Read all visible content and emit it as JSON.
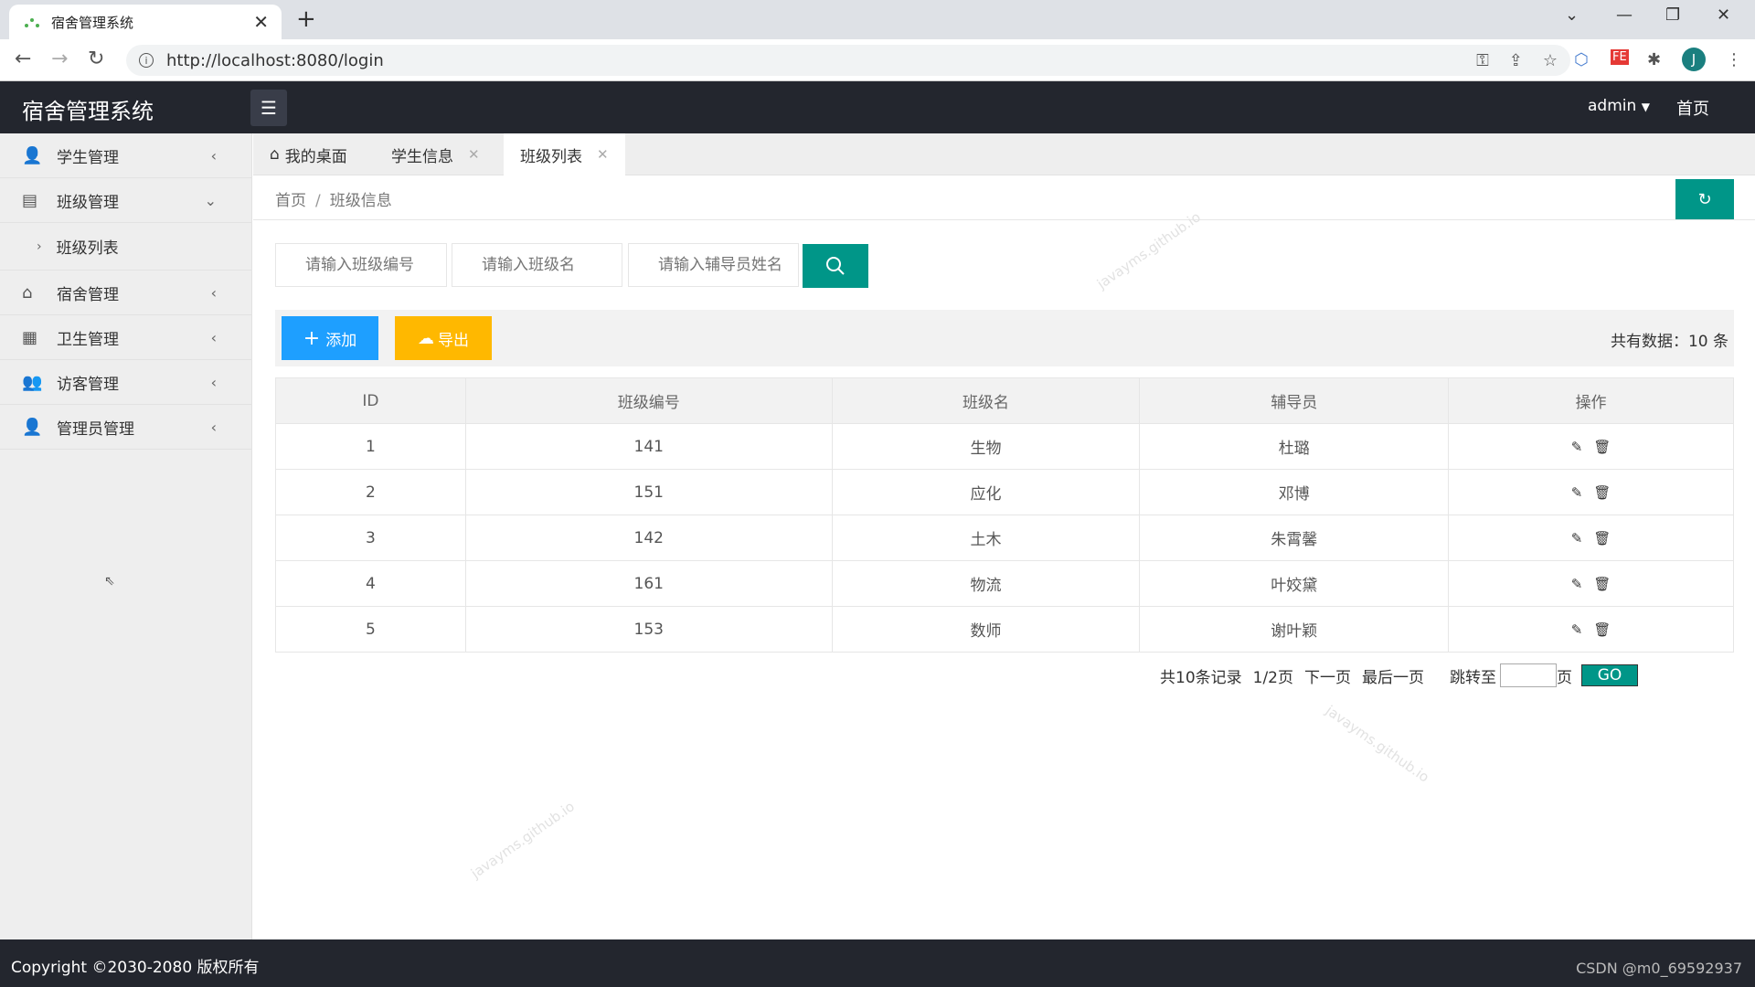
{
  "browser": {
    "tab_title": "宿舍管理系统",
    "tab_close": "✕",
    "new_tab": "+",
    "url": "http://localhost:8080/login",
    "profile_initial": "J",
    "ext_fe": "FE"
  },
  "header": {
    "app_title": "宿舍管理系统",
    "user": "admin",
    "home": "首页"
  },
  "sidebar": {
    "items": [
      {
        "label": "学生管理",
        "icon": "user-icon"
      },
      {
        "label": "班级管理",
        "icon": "document-icon"
      },
      {
        "label": "班级列表",
        "icon": "chevron-right-icon"
      },
      {
        "label": "宿舍管理",
        "icon": "sofa-icon"
      },
      {
        "label": "卫生管理",
        "icon": "clipboard-icon"
      },
      {
        "label": "访客管理",
        "icon": "users-icon"
      },
      {
        "label": "管理员管理",
        "icon": "admin-icon"
      }
    ]
  },
  "tabs": [
    {
      "label": "我的桌面"
    },
    {
      "label": "学生信息",
      "close": "✕"
    },
    {
      "label": "班级列表",
      "close": "✕"
    }
  ],
  "breadcrumb": {
    "home": "首页",
    "separator": "/",
    "current": "班级信息"
  },
  "search": {
    "class_no_placeholder": "请输入班级编号",
    "class_name_placeholder": "请输入班级名",
    "counselor_placeholder": "请输入辅导员姓名"
  },
  "toolbar": {
    "add_label": "添加",
    "export_label": "导出",
    "count_text": "共有数据：10 条"
  },
  "table": {
    "headers": [
      "ID",
      "班级编号",
      "班级名",
      "辅导员",
      "操作"
    ],
    "rows": [
      [
        "1",
        "141",
        "生物",
        "杜璐"
      ],
      [
        "2",
        "151",
        "应化",
        "邓博"
      ],
      [
        "3",
        "142",
        "土木",
        "朱霄馨"
      ],
      [
        "4",
        "161",
        "物流",
        "叶姣黛"
      ],
      [
        "5",
        "153",
        "数师",
        "谢叶颖"
      ]
    ]
  },
  "pagination": {
    "total": "共10条记录",
    "page": "1/2页",
    "next": "下一页",
    "last": "最后一页",
    "jump_label": "跳转至",
    "page_unit": "页",
    "go": "GO"
  },
  "footer": {
    "copyright": "Copyright ©2030-2080 版权所有",
    "csdn": "CSDN @m0_69592937"
  },
  "watermark": "javayms.github.io",
  "colors": {
    "primary": "#009688",
    "blue": "#1e9fff",
    "orange": "#ffb800",
    "header": "#23262e"
  }
}
